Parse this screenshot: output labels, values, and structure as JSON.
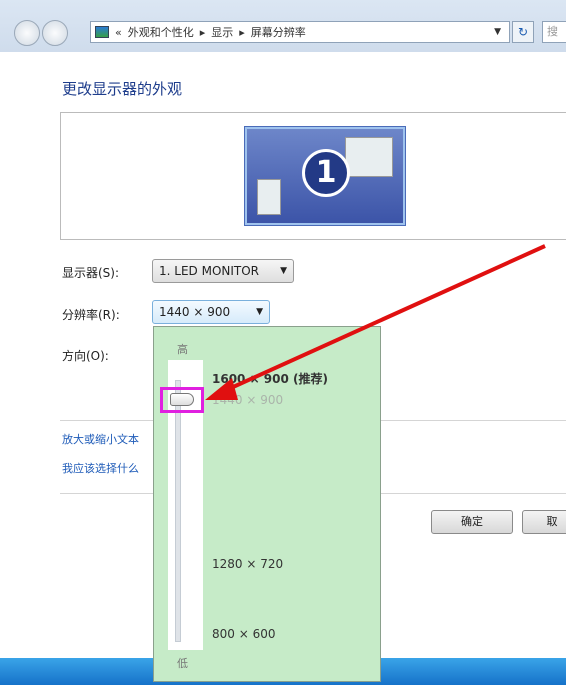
{
  "address_bar": {
    "prefix": "«",
    "crumbs": [
      "外观和个性化",
      "显示",
      "屏幕分辨率"
    ],
    "separator": "▸"
  },
  "search_placeholder": "搜",
  "page_title": "更改显示器的外观",
  "preview": {
    "monitor_number": "1"
  },
  "display": {
    "label": "显示器(S):",
    "value": "1. LED MONITOR"
  },
  "resolution": {
    "label": "分辨率(R):",
    "value": "1440 × 900"
  },
  "orientation": {
    "label": "方向(O):"
  },
  "links": [
    "放大或缩小文本",
    "我应该选择什么"
  ],
  "popup": {
    "high": "高",
    "low": "低",
    "options": [
      "1600 × 900 (推荐)",
      "1440 × 900",
      "1280 × 720",
      "800 × 600"
    ],
    "selected": "1440 × 900"
  },
  "buttons": {
    "ok": "确定",
    "cancel": "取"
  },
  "colors": {
    "popup_bg": "#c6ebc8",
    "highlight": "#e020e0",
    "arrow": "#e01010"
  }
}
